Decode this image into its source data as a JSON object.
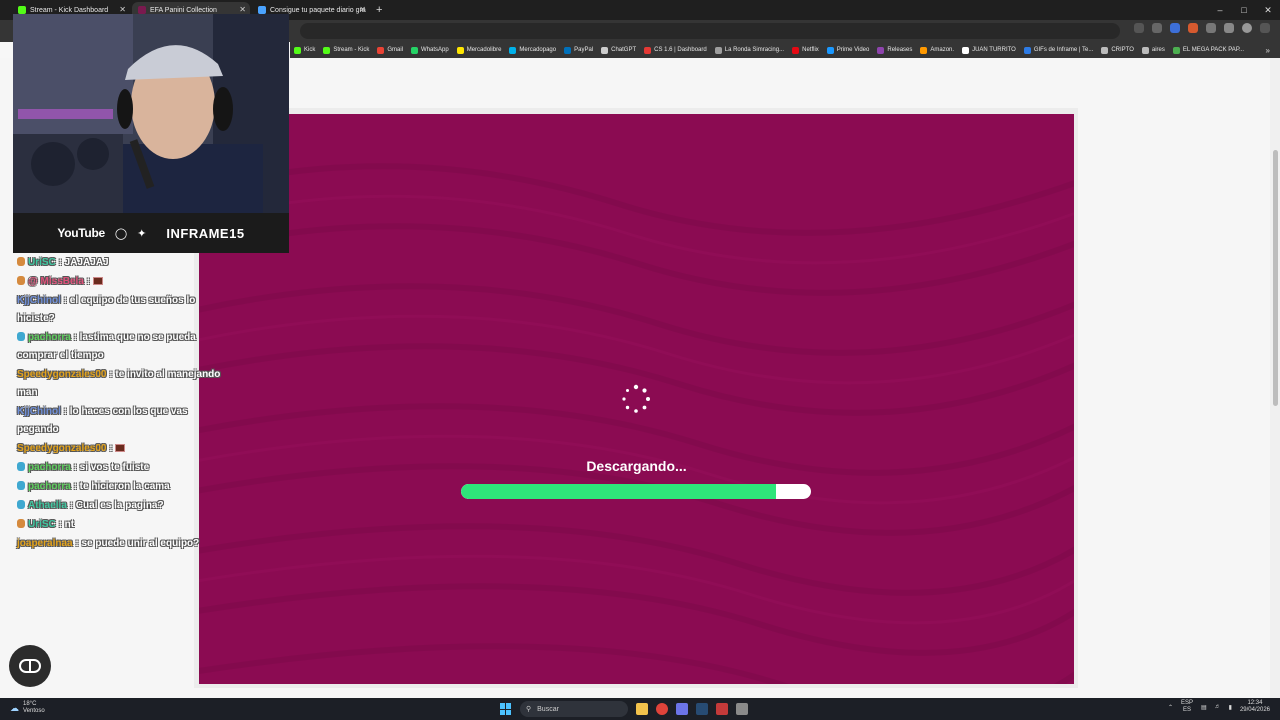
{
  "browser": {
    "tabs": [
      {
        "title": "Stream - Kick Dashboard",
        "color": "#53fc18"
      },
      {
        "title": "EFA Panini Collection",
        "color": "#7a1a4f"
      },
      {
        "title": "Consigue tu paquete diario gra",
        "color": "#4aa3ff"
      }
    ],
    "new_tab": "+",
    "bookmarks": [
      {
        "label": "Kick",
        "color": "#53fc18"
      },
      {
        "label": "Stream - Kick",
        "color": "#53fc18"
      },
      {
        "label": "Gmail",
        "color": "#ea4335"
      },
      {
        "label": "WhatsApp",
        "color": "#25d366"
      },
      {
        "label": "Mercadolibre",
        "color": "#ffe600"
      },
      {
        "label": "Mercadopago",
        "color": "#00b1ea"
      },
      {
        "label": "PayPal",
        "color": "#0070ba"
      },
      {
        "label": "ChatGPT",
        "color": "#cccccc"
      },
      {
        "label": "CS 1.6 | Dashboard",
        "color": "#e53935"
      },
      {
        "label": "La Ronda Simracing...",
        "color": "#9e9e9e"
      },
      {
        "label": "Netflix",
        "color": "#e50914"
      },
      {
        "label": "Prime Video",
        "color": "#1a98ff"
      },
      {
        "label": "Releases",
        "color": "#8e44ad"
      },
      {
        "label": "Amazon.",
        "color": "#ff9900"
      },
      {
        "label": "JUAN TURRITO",
        "color": "#ffffff"
      },
      {
        "label": "GIFs de Inframe | Te...",
        "color": "#2d7be5"
      },
      {
        "label": "CRIPTO",
        "color": "#bbbbbb"
      },
      {
        "label": "aires",
        "color": "#bbbbbb"
      },
      {
        "label": "EL MEGA PACK PAP...",
        "color": "#4caf50"
      }
    ]
  },
  "overlay": {
    "youtube_label": "YouTube",
    "handle": "INFRAME15"
  },
  "chat": [
    {
      "user": "UriSC",
      "color": "#3ec7a0",
      "badge": "#d58a3e",
      "text": ": JAJAJAJ",
      "emote": false
    },
    {
      "user": "@ MissBela",
      "color": "#e0507a",
      "badge": "#d58a3e",
      "text": ":",
      "emote": true
    },
    {
      "user": "KjjChinol",
      "color": "#6f8fd8",
      "badge": "",
      "text": ": el equipo de tus sueños lo hiciste?",
      "emote": false
    },
    {
      "user": "pachorra",
      "color": "#5ed15e",
      "badge": "#3fa8d0",
      "text": ": lastima que no se pueda comprar el tiempo",
      "emote": false
    },
    {
      "user": "Speedygonzales00",
      "color": "#e3a21a",
      "badge": "",
      "text": ": te invito al manejando man",
      "emote": false
    },
    {
      "user": "KjjChinol",
      "color": "#6f8fd8",
      "badge": "",
      "text": ": lo haces con los que vas pegando",
      "emote": false
    },
    {
      "user": "Speedygonzales00",
      "color": "#e3a21a",
      "badge": "",
      "text": ":",
      "emote": true
    },
    {
      "user": "pachorra",
      "color": "#5ed15e",
      "badge": "#3fa8d0",
      "text": ": si vos te fuiste",
      "emote": false
    },
    {
      "user": "pachorra",
      "color": "#5ed15e",
      "badge": "#3fa8d0",
      "text": ": te hicieron la cama",
      "emote": false
    },
    {
      "user": "Athaelia",
      "color": "#3ec7a0",
      "badge": "#3fa8d0",
      "text": ": Cual es la pagina?",
      "emote": false
    },
    {
      "user": "UriSC",
      "color": "#3ec7a0",
      "badge": "#d58a3e",
      "text": ": nt",
      "emote": false
    },
    {
      "user": "joaperalnaa",
      "color": "#e3a21a",
      "badge": "",
      "text": ": se puede unir al equipo?",
      "emote": false
    }
  ],
  "game": {
    "background": "#8b0b52",
    "loading_text": "Descargando...",
    "progress": 0.9,
    "progress_color": "#2ee57a"
  },
  "taskbar": {
    "weather_temp": "18°C",
    "weather_desc": "Ventoso",
    "search_placeholder": "Buscar",
    "lang_top": "ESP",
    "lang_bottom": "ES",
    "time": "12:34",
    "date": "29/04/2026"
  }
}
